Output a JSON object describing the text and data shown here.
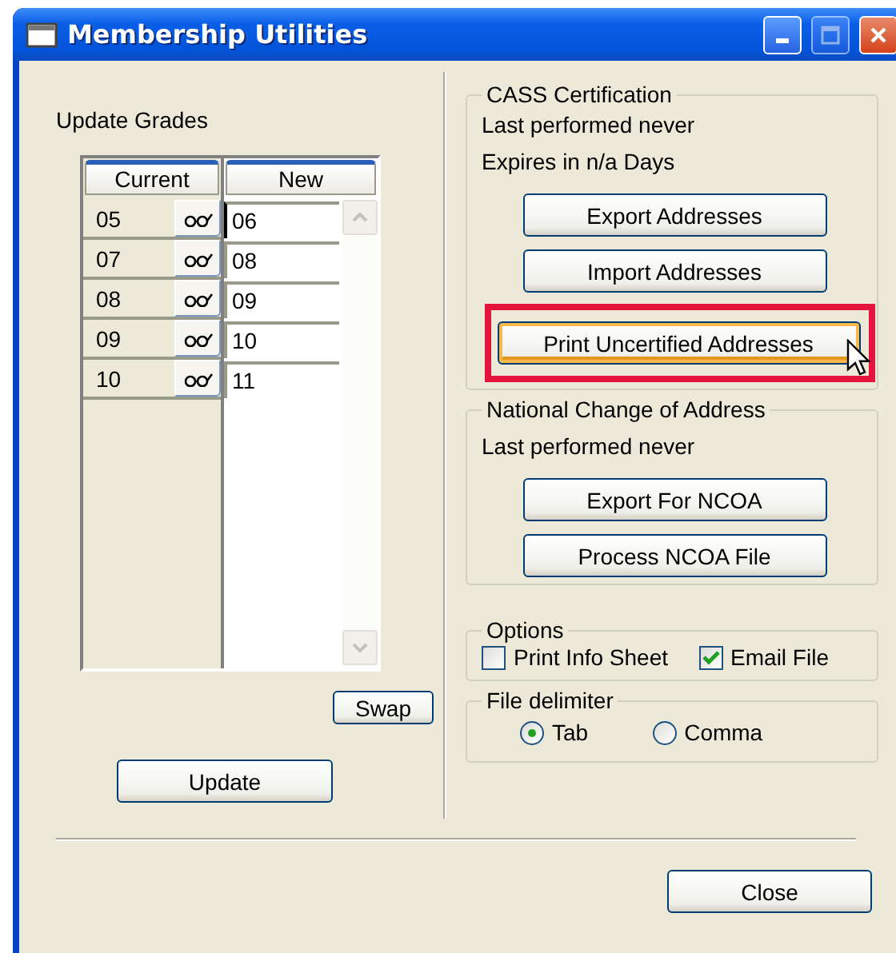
{
  "window": {
    "title": "Membership Utilities",
    "controls": [
      {
        "kind": "minimize",
        "disabled": false
      },
      {
        "kind": "maximize",
        "disabled": true
      },
      {
        "kind": "close",
        "disabled": false
      }
    ]
  },
  "update_grades": {
    "label": "Update Grades",
    "columns": [
      "Current",
      "New"
    ],
    "rows": [
      {
        "current": "05",
        "new": "06",
        "focused": true
      },
      {
        "current": "07",
        "new": "08",
        "focused": false
      },
      {
        "current": "08",
        "new": "09",
        "focused": false
      },
      {
        "current": "09",
        "new": "10",
        "focused": false
      },
      {
        "current": "10",
        "new": "11",
        "focused": false
      }
    ],
    "swap_button": "Swap",
    "update_button": "Update"
  },
  "cass": {
    "title": "CASS Certification",
    "lines": [
      "Last performed never",
      "Expires in n/a Days"
    ],
    "buttons": [
      {
        "label": "Export Addresses",
        "focused": false,
        "highlighted": false
      },
      {
        "label": "Import Addresses",
        "focused": false,
        "highlighted": false
      },
      {
        "label": "Print Uncertified Addresses",
        "focused": true,
        "highlighted": true
      }
    ]
  },
  "ncoa": {
    "title": "National Change of Address",
    "lines": [
      "Last performed never"
    ],
    "buttons": [
      {
        "label": "Export For NCOA",
        "focused": false,
        "highlighted": false
      },
      {
        "label": "Process NCOA File",
        "focused": false,
        "highlighted": false
      }
    ]
  },
  "options": {
    "title": "Options",
    "items": [
      {
        "label": "Print Info Sheet",
        "checked": false
      },
      {
        "label": "Email File",
        "checked": true
      }
    ]
  },
  "file_delimiter": {
    "title": "File delimiter",
    "items": [
      {
        "label": "Tab",
        "selected": true
      },
      {
        "label": "Comma",
        "selected": false
      }
    ]
  },
  "close_button": "Close"
}
